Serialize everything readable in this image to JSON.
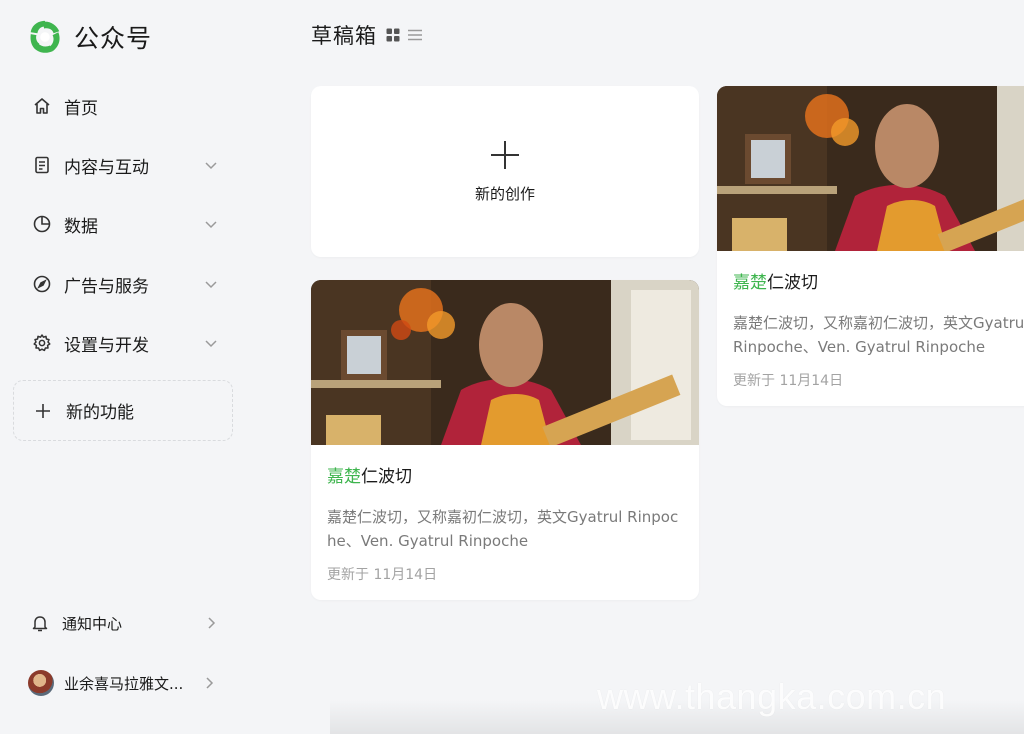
{
  "brand": {
    "name": "公众号",
    "accent": "#3fb54f"
  },
  "sidebar": {
    "items": [
      {
        "label": "首页",
        "icon": "home-icon",
        "expandable": false
      },
      {
        "label": "内容与互动",
        "icon": "document-icon",
        "expandable": true
      },
      {
        "label": "数据",
        "icon": "pie-chart-icon",
        "expandable": true
      },
      {
        "label": "广告与服务",
        "icon": "compass-icon",
        "expandable": true
      },
      {
        "label": "设置与开发",
        "icon": "gear-icon",
        "expandable": true
      }
    ],
    "new_feature": {
      "label": "新的功能",
      "icon": "plus-icon"
    },
    "bottom": [
      {
        "label": "通知中心",
        "icon": "bell-icon"
      },
      {
        "label": "业余喜马拉雅文...",
        "icon": "avatar"
      }
    ]
  },
  "main": {
    "title": "草稿箱",
    "view_toggle": [
      "grid-view-icon",
      "list-view-icon"
    ],
    "create_card": {
      "label": "新的创作"
    },
    "articles": [
      {
        "title_highlight": "嘉楚",
        "title_rest": "仁波切",
        "description": "嘉楚仁波切，又称嘉初仁波切，英文Gyatrul Rinpoche、Ven. Gyatrul Rinpoche",
        "date": "更新于 11月14日"
      },
      {
        "title_highlight": "嘉楚",
        "title_rest": "仁波切",
        "description": "嘉楚仁波切，又称嘉初仁波切，英文Gyatrul Rinpoche、Ven. Gyatrul Rinpoche",
        "date": "更新于 11月14日"
      }
    ]
  },
  "watermark": "www.thangka.com.cn"
}
